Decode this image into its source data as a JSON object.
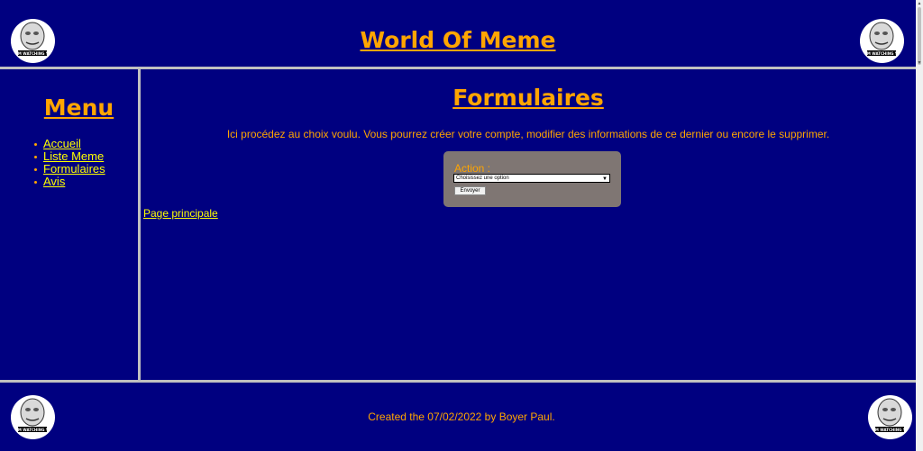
{
  "header": {
    "title": "World Of Meme",
    "badge_caption": "IM WATCHING Y"
  },
  "sidebar": {
    "title": "Menu",
    "items": [
      {
        "label": "Accueil"
      },
      {
        "label": "Liste Meme"
      },
      {
        "label": "Formulaires"
      },
      {
        "label": "Avis"
      }
    ]
  },
  "main": {
    "title": "Formulaires",
    "description": "Ici procédez au choix voulu. Vous pourrez créer votre compte, modifier des informations de ce dernier ou encore le supprimer.",
    "form": {
      "label": "Action :",
      "select_value": "Choisissez une option",
      "submit_label": "Envoyer"
    },
    "link": "Page principale"
  },
  "footer": {
    "text": "Created the 07/02/2022 by Boyer Paul."
  },
  "colors": {
    "background": "#000080",
    "accent": "#ffa500",
    "link": "#ffff00",
    "form_bg": "#7f7673",
    "divider": "#c0c0c0"
  },
  "icons": {
    "badge": "meme-face-icon"
  }
}
